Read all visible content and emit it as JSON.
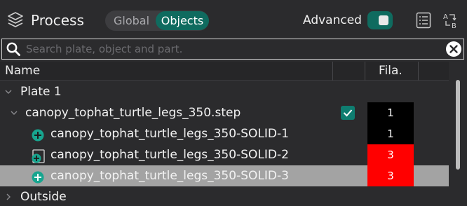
{
  "header": {
    "title": "Process",
    "title_icon": "layers-icon",
    "scope_global": "Global",
    "scope_objects": "Objects",
    "scope_selected": "Objects",
    "advanced_label": "Advanced",
    "advanced_on": true,
    "tools": [
      "list-icon",
      "ab-swap-icon"
    ]
  },
  "search": {
    "placeholder": "Search plate, object and part.",
    "value": ""
  },
  "columns": {
    "name": "Name",
    "filament": "Fila."
  },
  "tree": {
    "plate": "Plate 1",
    "object": {
      "label": "canopy_tophat_turtle_legs_350.step",
      "checked": true,
      "filament": "1",
      "filament_color": "#000000"
    },
    "parts": [
      {
        "label": "canopy_tophat_turtle_legs_350-SOLID-1",
        "icon": "add-part-icon",
        "filament": "1",
        "filament_color": "#000000",
        "selected": false
      },
      {
        "label": "canopy_tophat_turtle_legs_350-SOLID-2",
        "icon": "negative-part-icon",
        "filament": "3",
        "filament_color": "#ff0000",
        "selected": false
      },
      {
        "label": "canopy_tophat_turtle_legs_350-SOLID-3",
        "icon": "add-part-icon",
        "filament": "3",
        "filament_color": "#ff0000",
        "selected": true
      }
    ],
    "outside": "Outside"
  },
  "colors": {
    "accent": "#0f6b5f",
    "background": "#2b2b2d",
    "selected_row": "#a3a3a3"
  }
}
